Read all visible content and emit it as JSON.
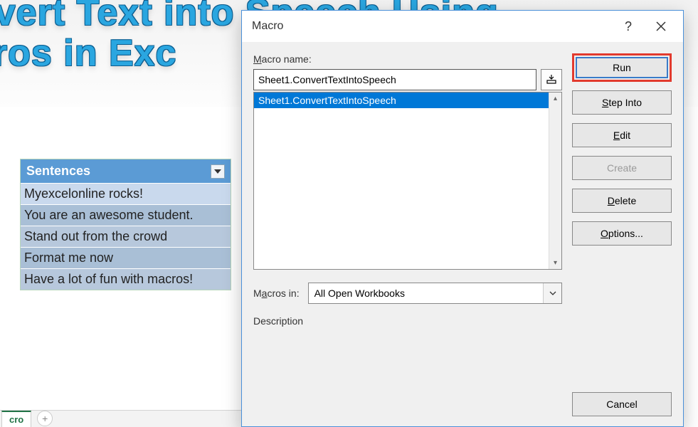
{
  "decorative": {
    "line1": "nvert Text into Speech Using",
    "line2": "cros in Exc"
  },
  "table": {
    "header": "Sentences",
    "rows": [
      "Myexcelonline rocks!",
      "You are an awesome student.",
      "Stand out from the crowd",
      "Format me now",
      "Have a lot of fun with macros!"
    ]
  },
  "tabs": {
    "active": "cro",
    "plus": "+"
  },
  "dialog": {
    "title": "Macro",
    "help": "?",
    "labels": {
      "macro_name": "Macro name:",
      "macros_in": "Macros in:",
      "description": "Description"
    },
    "name_value": "Sheet1.ConvertTextIntoSpeech",
    "list": [
      "Sheet1.ConvertTextIntoSpeech"
    ],
    "macros_in_value": "All Open Workbooks",
    "buttons": {
      "run": "Run",
      "step_into": "Step Into",
      "edit": "Edit",
      "create": "Create",
      "delete": "Delete",
      "options": "Options...",
      "cancel": "Cancel"
    }
  }
}
